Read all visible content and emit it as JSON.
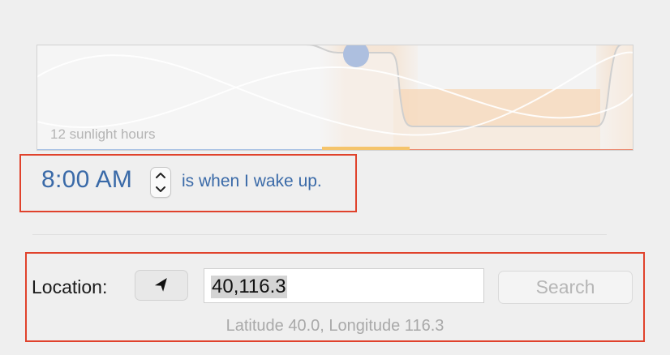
{
  "sunlight": {
    "label": "12 sunlight hours",
    "sun_color": "#adbfdf",
    "night_color": "#f6d9bd",
    "wake_marker_color": "#f5c46b",
    "night_line_color": "#e9694a"
  },
  "wake": {
    "time": "8:00 AM",
    "suffix": "is when I wake up."
  },
  "location": {
    "label": "Location:",
    "locate_icon": "location-arrow-icon",
    "value": "40,116.3",
    "search_label": "Search",
    "coords_text": "Latitude 40.0, Longitude 116.3"
  },
  "colors": {
    "accent_text": "#3a6aa8",
    "highlight_border": "#e0422c"
  }
}
